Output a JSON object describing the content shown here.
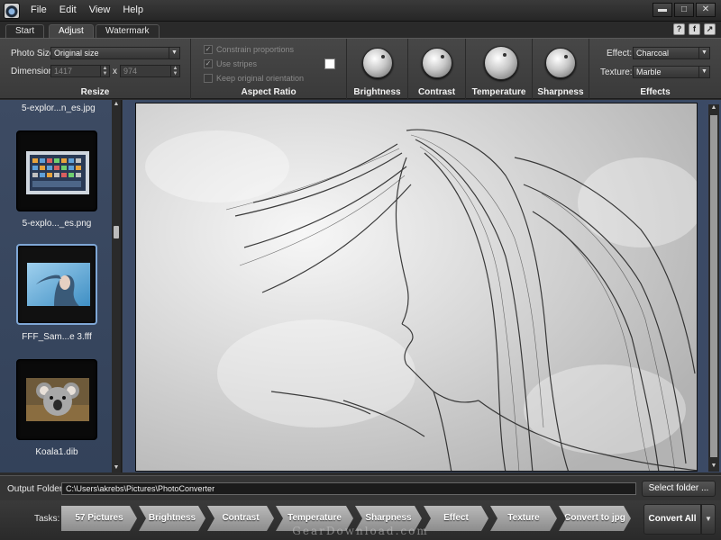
{
  "menu": {
    "items": [
      "File",
      "Edit",
      "View",
      "Help"
    ]
  },
  "window": {
    "minimize": "▬",
    "maximize": "□",
    "close": "✕"
  },
  "tabs": [
    {
      "label": "Start",
      "active": false
    },
    {
      "label": "Adjust",
      "active": true
    },
    {
      "label": "Watermark",
      "active": false
    }
  ],
  "tab_icons": [
    "?",
    "f",
    "↗"
  ],
  "resize": {
    "title": "Resize",
    "photo_size_label": "Photo Size:",
    "photo_size_value": "Original size",
    "dimension_label": "Dimension:",
    "width_value": "1417",
    "x_label": "x",
    "height_value": "974"
  },
  "aspect": {
    "title": "Aspect Ratio",
    "constrain": "Constrain proportions",
    "stripes": "Use stripes",
    "orientation": "Keep original orientation"
  },
  "knobs": {
    "brightness": "Brightness",
    "contrast": "Contrast",
    "temperature": "Temperature",
    "sharpness": "Sharpness"
  },
  "effects": {
    "title": "Effects",
    "effect_label": "Effect:",
    "effect_value": "Charcoal",
    "texture_label": "Texture:",
    "texture_value": "Marble"
  },
  "thumbnails": {
    "top_name": "5-explor...n_es.jpg",
    "items": [
      {
        "name": "5-explo..._es.png"
      },
      {
        "name": "FFF_Sam...e 3.fff"
      },
      {
        "name": "Koala1.dib"
      }
    ]
  },
  "output": {
    "label": "Output Folder:",
    "path": "C:\\Users\\akrebs\\Pictures\\PhotoConverter",
    "select_button": "Select folder ..."
  },
  "tasks": {
    "label": "Tasks:",
    "steps": [
      "57 Pictures",
      "Brightness",
      "Contrast",
      "Temperature",
      "Sharpness",
      "Effect",
      "Texture",
      "Convert to jpg"
    ],
    "convert_all": "Convert All",
    "dropdown": "▼"
  },
  "watermark": "GearDownload.com",
  "colors": {
    "panel_blue": "#3d4b63",
    "accent_selection": "#7fa7d6",
    "step_gray": "#a5a5a5"
  }
}
